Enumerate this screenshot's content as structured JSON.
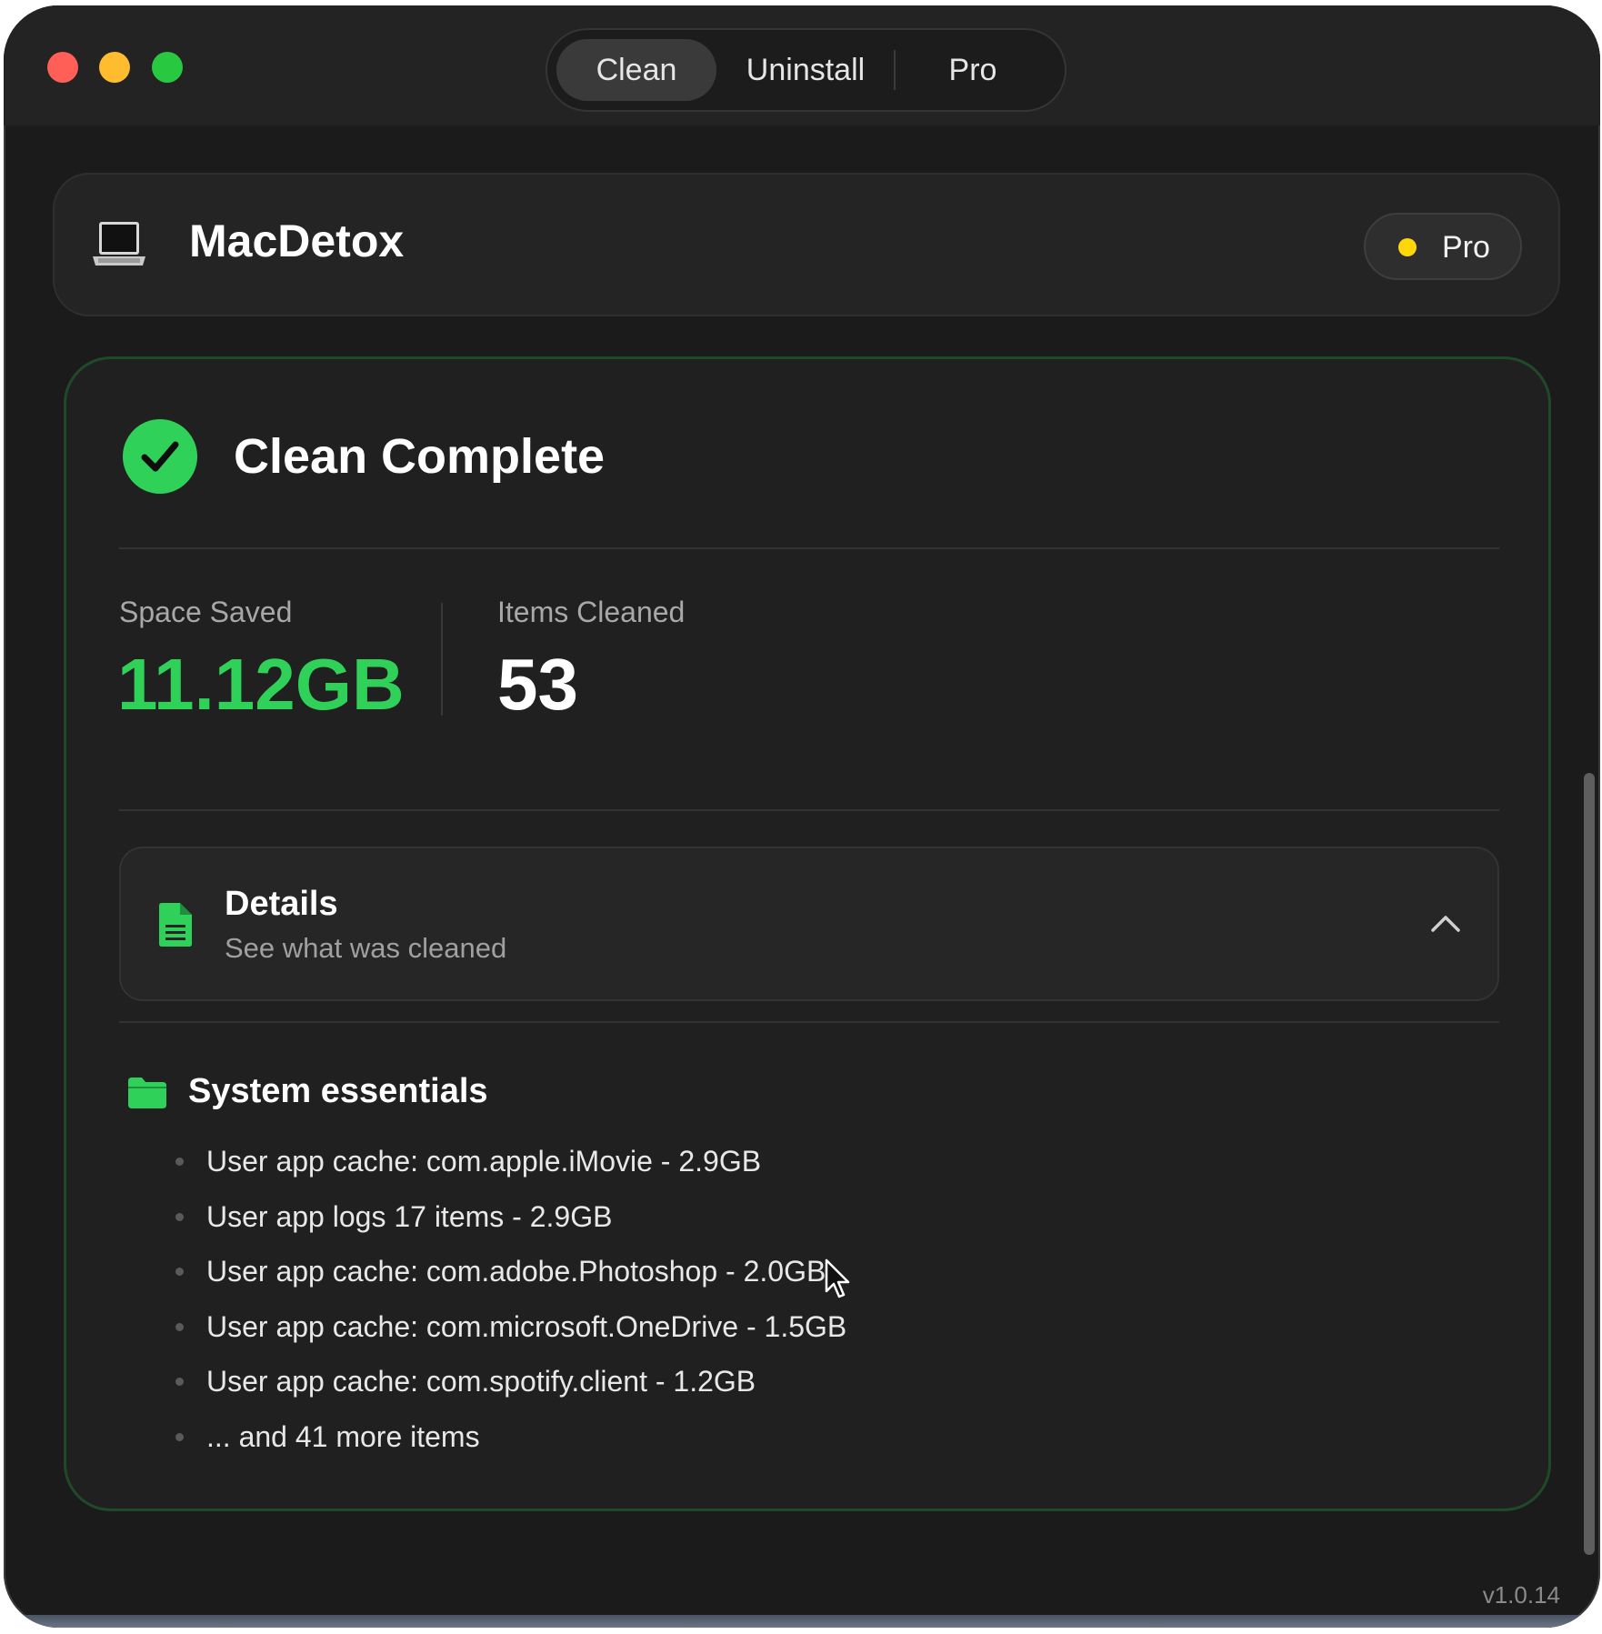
{
  "window": {
    "tabs": [
      {
        "label": "Clean",
        "selected": true
      },
      {
        "label": "Uninstall",
        "selected": false
      },
      {
        "label": "Pro",
        "selected": false
      }
    ]
  },
  "header": {
    "app_icon": "laptop-icon",
    "title": "MacDetox",
    "badge": {
      "label": "Pro",
      "dot_color": "#ffd60a"
    }
  },
  "result": {
    "status_icon": "checkmark-circle-icon",
    "title": "Clean Complete",
    "stats": {
      "space_saved_label": "Space Saved",
      "space_saved_value": "11.12GB",
      "items_cleaned_label": "Items Cleaned",
      "items_cleaned_value": "53"
    },
    "details": {
      "icon": "document-icon",
      "title": "Details",
      "subtitle": "See what was cleaned",
      "expanded": true,
      "toggle_icon": "chevron-up-icon"
    },
    "groups": [
      {
        "icon": "folder-icon",
        "title": "System essentials",
        "items": [
          "User app cache: com.apple.iMovie - 2.9GB",
          "User app logs 17 items - 2.9GB",
          "User app cache: com.adobe.Photoshop - 2.0GB",
          "User app cache: com.microsoft.OneDrive - 1.5GB",
          "User app cache: com.spotify.client - 1.2GB",
          "... and 41 more items"
        ]
      }
    ]
  },
  "footer": {
    "version": "v1.0.14"
  },
  "colors": {
    "accent_green": "#30d158",
    "background": "#1b1b1b",
    "card": "#202020",
    "card_border": "#1f4a28",
    "pro_dot": "#ffd60a"
  }
}
